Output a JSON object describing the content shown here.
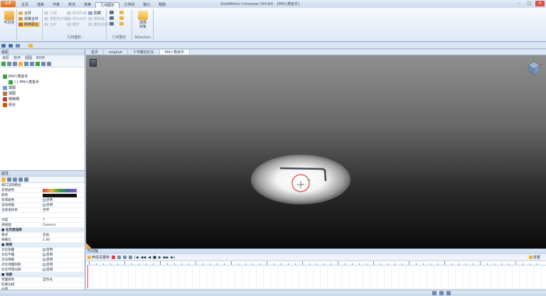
{
  "window": {
    "title": "SolidWorks Composer (64-bit) - [M4六角扳手]",
    "app_button": "文件"
  },
  "tabs": [
    {
      "label": "主页",
      "active": false
    },
    {
      "label": "渲染",
      "active": false
    },
    {
      "label": "作者",
      "active": false
    },
    {
      "label": "样式",
      "active": false
    },
    {
      "label": "变换",
      "active": false
    },
    {
      "label": "几何图形",
      "active": true
    },
    {
      "label": "工作间",
      "active": false
    },
    {
      "label": "窗口",
      "active": false
    },
    {
      "label": "帮助",
      "active": false
    }
  ],
  "ribbon": {
    "groups": [
      {
        "label": "",
        "big_button": "可见性"
      },
      {
        "label": "",
        "buttons": [
          "合并",
          "拆散合并",
          "转到组合"
        ]
      },
      {
        "label": "几何图形",
        "buttons": [
          "分组",
          "按颜色分解",
          "合并",
          "取消分组",
          "转为合并",
          "细分",
          "隐藏",
          "删除面",
          "删除边线"
        ]
      },
      {
        "label": "几何图形",
        "buttons": [
          "",
          "",
          ""
        ]
      },
      {
        "label": "Sélection",
        "buttons": [
          "选择",
          "对象"
        ]
      }
    ]
  },
  "left_panel": {
    "title": "装配",
    "tabs": [
      "装配",
      "协作",
      "视图",
      "BOM"
    ],
    "tree": [
      {
        "label": "M4六角扳手",
        "indent": 0,
        "icon_color": "#3aa03a"
      },
      {
        "label": "M4六角扳手",
        "indent": 1,
        "icon_color": "#3aa03a",
        "prefix": "(-)"
      },
      {
        "label": "填图",
        "indent": 0,
        "icon_color": "#7a9cc4"
      },
      {
        "label": "视图",
        "indent": 0,
        "icon_color": "#b0774c"
      },
      {
        "label": "微微细",
        "indent": 0,
        "icon_color": "#c0392b"
      },
      {
        "label": "组合",
        "indent": 0,
        "icon_color": "#d35400"
      }
    ]
  },
  "props_panel": {
    "title": "属性",
    "rows": [
      {
        "label": "视口渲染模式",
        "value": "",
        "group": false
      },
      {
        "label": "背景颜色",
        "value": "",
        "group": false,
        "gradient": true
      },
      {
        "label": "颜色",
        "value": "",
        "group": false,
        "swatch": true
      },
      {
        "label": "背景颜色",
        "value": "启用",
        "group": false,
        "check": true
      },
      {
        "label": "自动缩放",
        "value": "启用",
        "group": false,
        "check": true
      },
      {
        "label": "渲染坐标系",
        "value": "世界",
        "group": false
      },
      {
        "label": "",
        "value": "",
        "group": false
      },
      {
        "label": "深度",
        "value": "7",
        "group": false
      },
      {
        "label": "透视图",
        "value": "Camera",
        "group": false
      },
      {
        "label": "■ 在页面渲染",
        "value": "",
        "group": true
      },
      {
        "label": "格式",
        "value": "自由",
        "group": false
      },
      {
        "label": "离散比",
        "value": "1.00",
        "group": false
      },
      {
        "label": "■ 照明",
        "value": "",
        "group": true
      },
      {
        "label": "对比剖面",
        "value": "启用",
        "group": false,
        "check": true
      },
      {
        "label": "对比平面",
        "value": "启用",
        "group": false,
        "check": true
      },
      {
        "label": "对比网格",
        "value": "启用",
        "group": false,
        "check": true
      },
      {
        "label": "对比地面阴影",
        "value": "启用",
        "group": false,
        "check": true
      },
      {
        "label": "对比环境光照",
        "value": "启用",
        "group": false,
        "check": true
      },
      {
        "label": "■ 地面",
        "value": "",
        "group": true
      },
      {
        "label": "地面颜色",
        "value": "自然光",
        "group": false
      },
      {
        "label": "轮廓边线",
        "value": "",
        "group": false
      },
      {
        "label": "位置",
        "value": "",
        "group": false
      }
    ]
  },
  "view_tabs": [
    {
      "label": "首页",
      "active": false
    },
    {
      "label": "original",
      "active": false
    },
    {
      "label": "十字螺丝钉头",
      "active": false
    },
    {
      "label": "M4六角扳手",
      "active": true
    }
  ],
  "timeline": {
    "title": "时间轴",
    "buttons": [
      "养成关键帧",
      "",
      "",
      "",
      "",
      "放置"
    ],
    "playback": [
      "|◀",
      "◀◀",
      "◀",
      "■",
      "▶",
      "▶▶",
      "▶|"
    ]
  },
  "colors": {
    "accent_orange": "#f7a33b",
    "ribbon_bg": "#eaf0f8",
    "viewport_top": "#8f8f8f",
    "viewport_bottom": "#0b0b0b",
    "red_circle": "#e0413a"
  }
}
